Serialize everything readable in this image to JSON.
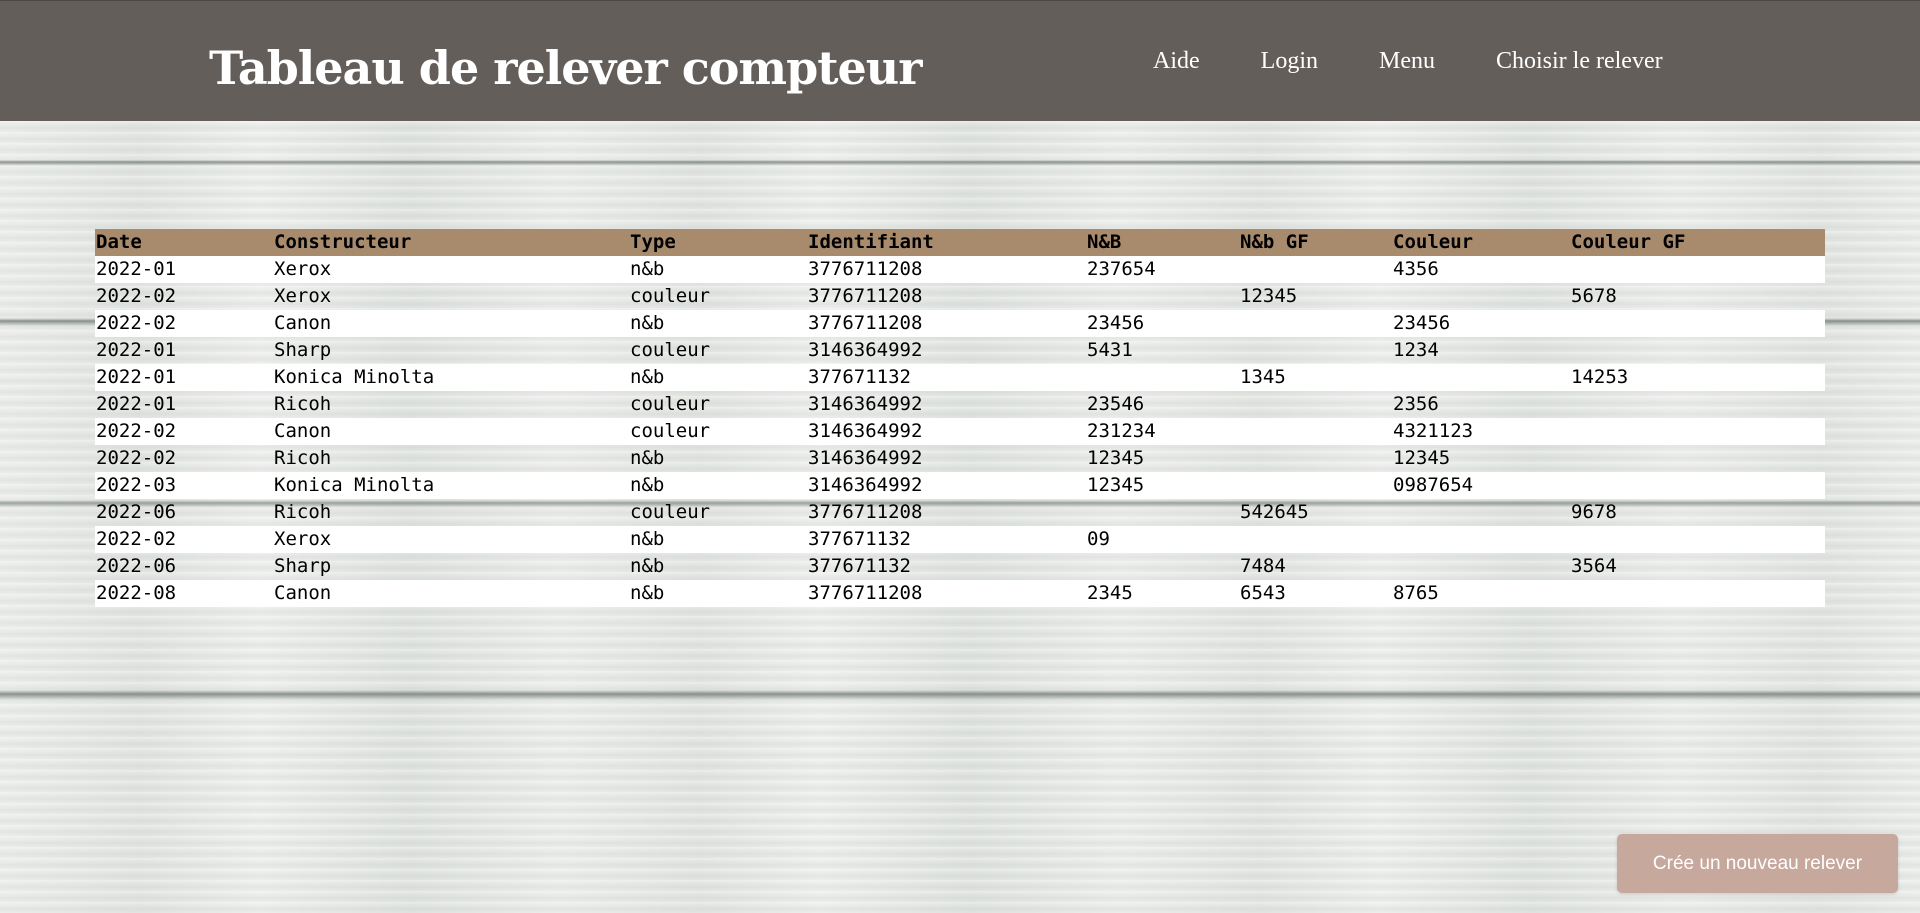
{
  "header": {
    "title": "Tableau de relever compteur",
    "nav": [
      {
        "label": "Aide"
      },
      {
        "label": "Login"
      },
      {
        "label": "Menu"
      },
      {
        "label": "Choisir le relever"
      }
    ]
  },
  "table": {
    "columns": [
      "Date",
      "Constructeur",
      "Type",
      "Identifiant",
      "N&B",
      "N&b GF",
      "Couleur",
      "Couleur GF"
    ],
    "rows": [
      [
        "2022-01",
        "Xerox",
        "n&b",
        "3776711208",
        "237654",
        "",
        "4356",
        ""
      ],
      [
        "2022-02",
        "Xerox",
        "couleur",
        "3776711208",
        "",
        "12345",
        "",
        "5678"
      ],
      [
        "2022-02",
        "Canon",
        "n&b",
        "3776711208",
        "23456",
        "",
        "23456",
        ""
      ],
      [
        "2022-01",
        "Sharp",
        "couleur",
        "3146364992",
        "5431",
        "",
        "1234",
        ""
      ],
      [
        "2022-01",
        "Konica Minolta",
        "n&b",
        "377671132",
        "",
        "1345",
        "",
        "14253"
      ],
      [
        "2022-01",
        "Ricoh",
        "couleur",
        "3146364992",
        "23546",
        "",
        "2356",
        ""
      ],
      [
        "2022-02",
        "Canon",
        "couleur",
        "3146364992",
        "231234",
        "",
        "4321123",
        ""
      ],
      [
        "2022-02",
        "Ricoh",
        "n&b",
        "3146364992",
        "12345",
        "",
        "12345",
        ""
      ],
      [
        "2022-03",
        "Konica Minolta",
        "n&b",
        "3146364992",
        "12345",
        "",
        "0987654",
        ""
      ],
      [
        "2022-06",
        "Ricoh",
        "couleur",
        "3776711208",
        "",
        "542645",
        "",
        "9678"
      ],
      [
        "2022-02",
        "Xerox",
        "n&b",
        "377671132",
        "09",
        "",
        "",
        ""
      ],
      [
        "2022-06",
        "Sharp",
        "n&b",
        "377671132",
        "",
        "7484",
        "",
        "3564"
      ],
      [
        "2022-08",
        "Canon",
        "n&b",
        "3776711208",
        "2345",
        "6543",
        "8765",
        ""
      ]
    ]
  },
  "actions": {
    "new_reading_label": "Crée un nouveau relever"
  },
  "colors": {
    "header_bg": "#645e5b",
    "table_header_bg": "#a88a6d",
    "button_bg": "#c6a89c"
  }
}
